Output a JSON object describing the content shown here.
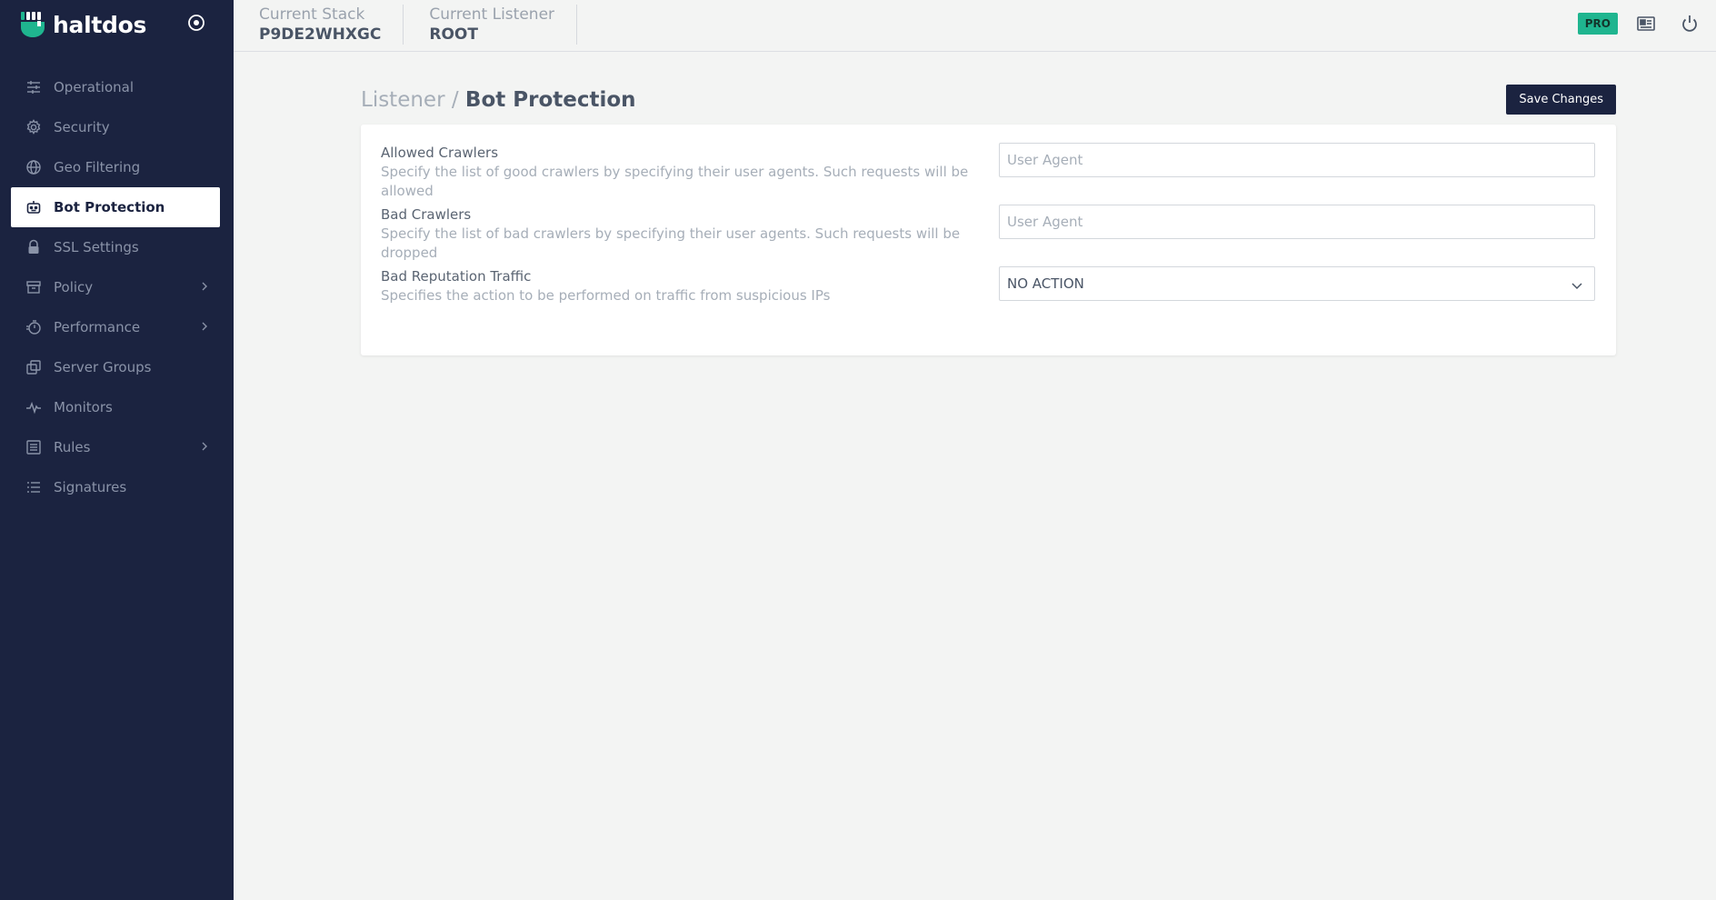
{
  "brand": {
    "name": "haltdos"
  },
  "sidebar": {
    "items": [
      {
        "label": "Operational",
        "icon": "sliders-icon",
        "has_children": false,
        "active": false
      },
      {
        "label": "Security",
        "icon": "gear-icon",
        "has_children": false,
        "active": false
      },
      {
        "label": "Geo Filtering",
        "icon": "globe-icon",
        "has_children": false,
        "active": false
      },
      {
        "label": "Bot Protection",
        "icon": "robot-icon",
        "has_children": false,
        "active": true
      },
      {
        "label": "SSL Settings",
        "icon": "lock-icon",
        "has_children": false,
        "active": false
      },
      {
        "label": "Policy",
        "icon": "archive-icon",
        "has_children": true,
        "active": false
      },
      {
        "label": "Performance",
        "icon": "stopwatch-icon",
        "has_children": true,
        "active": false
      },
      {
        "label": "Server Groups",
        "icon": "copy-icon",
        "has_children": false,
        "active": false
      },
      {
        "label": "Monitors",
        "icon": "pulse-icon",
        "has_children": false,
        "active": false
      },
      {
        "label": "Rules",
        "icon": "list-box-icon",
        "has_children": true,
        "active": false
      },
      {
        "label": "Signatures",
        "icon": "list-icon",
        "has_children": false,
        "active": false
      }
    ]
  },
  "topbar": {
    "stack_label": "Current Stack",
    "stack_value": "P9DE2WHXGC",
    "listener_label": "Current Listener",
    "listener_value": "ROOT",
    "badge": "PRO",
    "colors": {
      "sidebar_bg": "#1b2340",
      "badge_bg": "#1fb58f"
    }
  },
  "page": {
    "breadcrumb_parent": "Listener",
    "breadcrumb_sep": " / ",
    "title": "Bot Protection",
    "save_label": "Save Changes"
  },
  "settings": {
    "allowed": {
      "title": "Allowed Crawlers",
      "desc": "Specify the list of good crawlers by specifying their user agents. Such requests will be allowed",
      "placeholder": "User Agent"
    },
    "bad": {
      "title": "Bad Crawlers",
      "desc": "Specify the list of bad crawlers by specifying their user agents. Such requests will be dropped",
      "placeholder": "User Agent"
    },
    "reputation": {
      "title": "Bad Reputation Traffic",
      "desc": "Specifies the action to be performed on traffic from suspicious IPs",
      "selected": "NO ACTION"
    }
  }
}
